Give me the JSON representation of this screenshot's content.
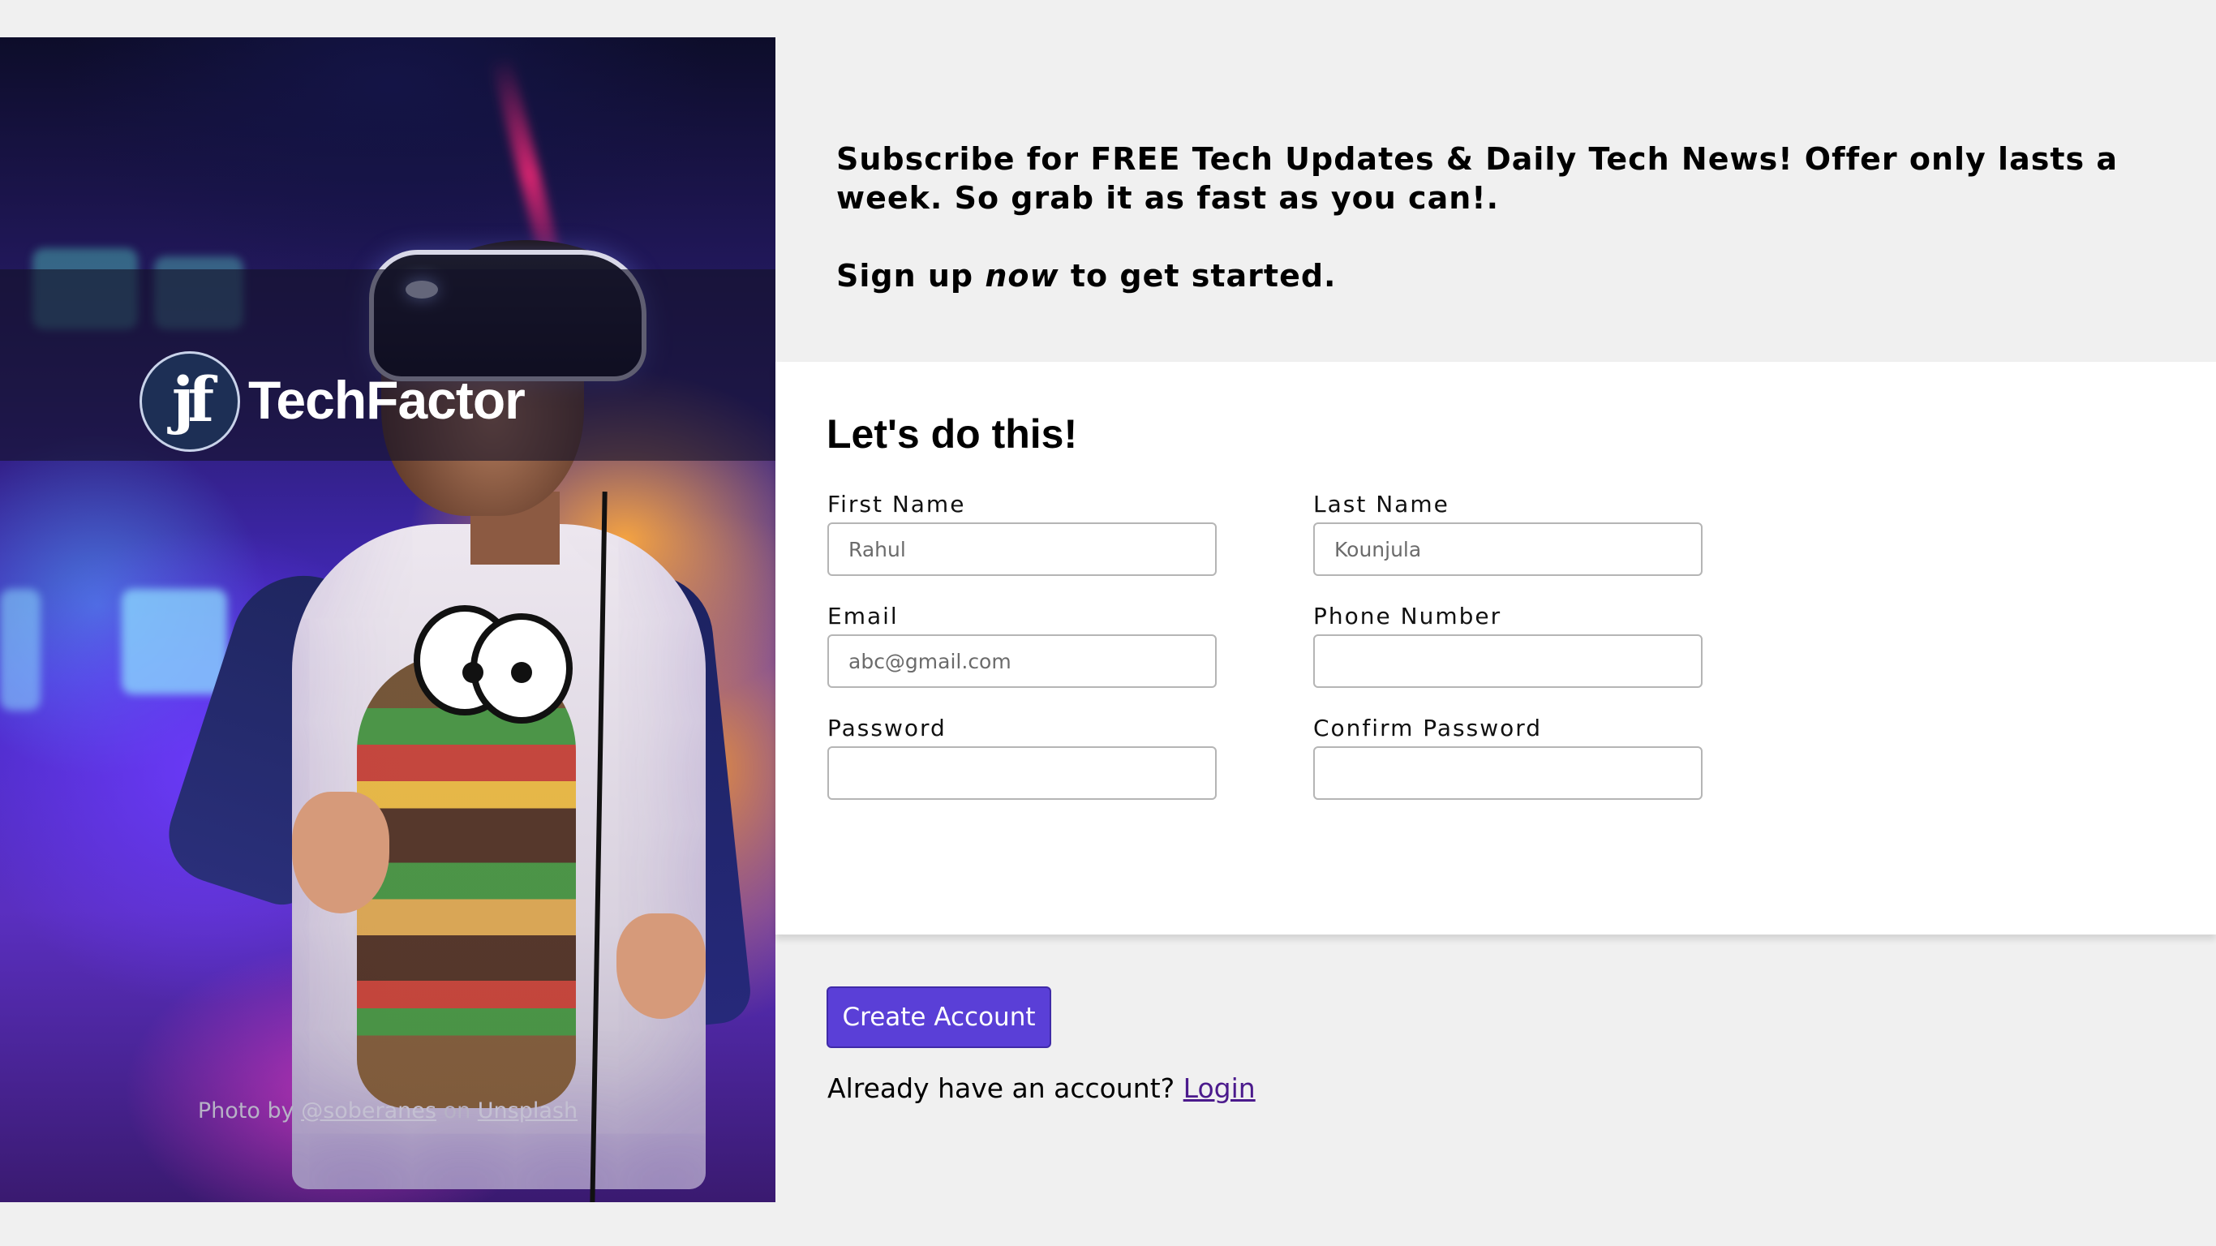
{
  "hero": {
    "brand_mark": "jf",
    "brand_name": "TechFactor",
    "credit_prefix": "Photo by",
    "credit_author": "@soberanes",
    "credit_middle": "on",
    "credit_site": "Unsplash"
  },
  "intro": {
    "offer_text": "Subscribe for FREE Tech Updates & Daily Tech News! Offer only lasts a week. So grab it as fast as you can!.",
    "signup_prefix": "Sign up",
    "signup_emphasis": "now",
    "signup_suffix": "to get started."
  },
  "form": {
    "title": "Let's do this!",
    "fields": {
      "first_name": {
        "label": "First Name",
        "placeholder": "Rahul",
        "value": ""
      },
      "last_name": {
        "label": "Last Name",
        "placeholder": "Kounjula",
        "value": ""
      },
      "email": {
        "label": "Email",
        "placeholder": "abc@gmail.com",
        "value": ""
      },
      "phone": {
        "label": "Phone Number",
        "placeholder": "",
        "value": ""
      },
      "password": {
        "label": "Password",
        "placeholder": "",
        "value": ""
      },
      "confirm_password": {
        "label": "Confirm Password",
        "placeholder": "",
        "value": ""
      }
    }
  },
  "actions": {
    "create_account_label": "Create Account",
    "login_prompt": "Already have an account?",
    "login_link": "Login"
  },
  "colors": {
    "page_background": "#f0f0f0",
    "card_background": "#ffffff",
    "button_accent": "#5a3fd7",
    "link_color": "#4b1a8c"
  }
}
